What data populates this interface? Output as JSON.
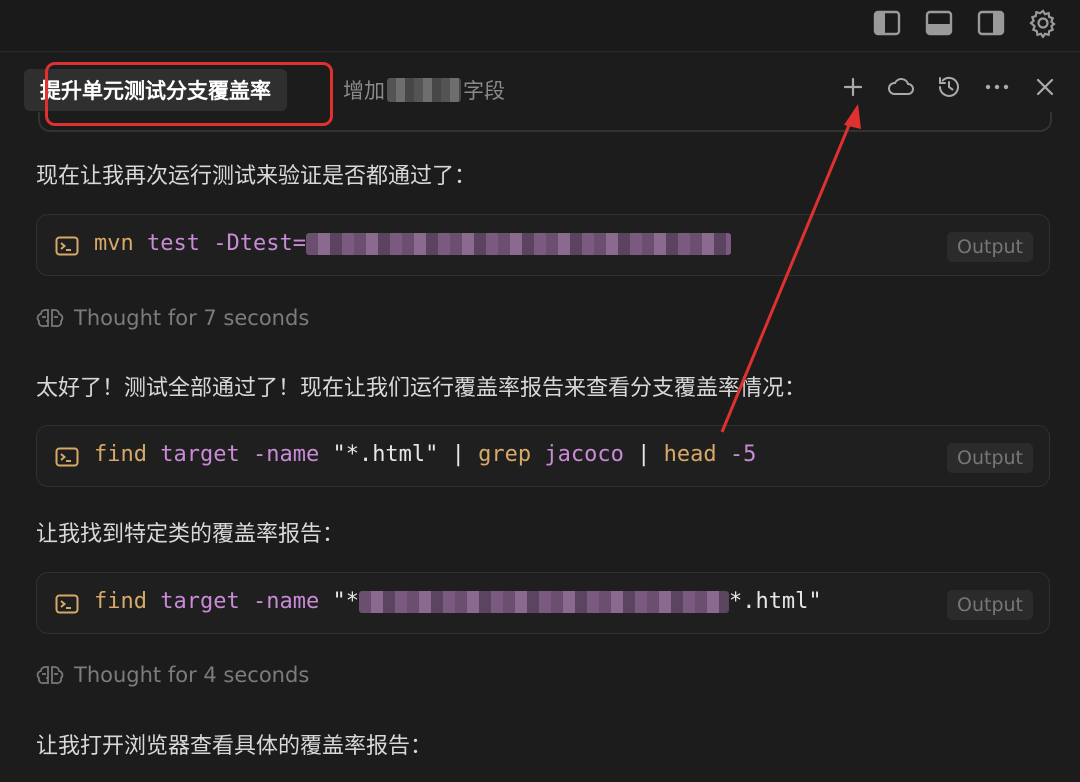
{
  "tabs": {
    "active_label": "提升单元测试分支覆盖率",
    "inactive_prefix": "增加",
    "inactive_suffix": "字段"
  },
  "messages": [
    "现在让我再次运行测试来验证是否都通过了：",
    "太好了！测试全部通过了！现在让我们运行覆盖率报告来查看分支覆盖率情况：",
    "让我找到特定类的覆盖率报告：",
    "让我打开浏览器查看具体的覆盖率报告："
  ],
  "thoughts": [
    "Thought for 7 seconds",
    "Thought for 4 seconds"
  ],
  "commands": [
    {
      "cmd": "mvn",
      "arg1": "test",
      "arg2": "-Dtest=",
      "output": "Output"
    },
    {
      "cmd": "find",
      "arg1": "target",
      "arg2": "-name",
      "str": "\"*.html\"",
      "pipe1": "|",
      "cmd2": "grep",
      "arg3": "jacoco",
      "pipe2": "|",
      "cmd3": "head",
      "arg4": "-5",
      "output": "Output"
    },
    {
      "cmd": "find",
      "arg1": "target",
      "arg2": "-name",
      "str_start": "\"*",
      "str_end": "*.html\"",
      "output": "Output"
    }
  ],
  "icons": {
    "layout": [
      "sidebar-left-icon",
      "panel-bottom-icon",
      "sidebar-right-icon",
      "gear-icon"
    ],
    "actions": [
      "plus-icon",
      "cloud-icon",
      "history-icon",
      "more-icon",
      "close-icon"
    ]
  },
  "colors": {
    "highlight": "#e03131",
    "command": "#d7a968",
    "argument": "#c98ad6"
  }
}
